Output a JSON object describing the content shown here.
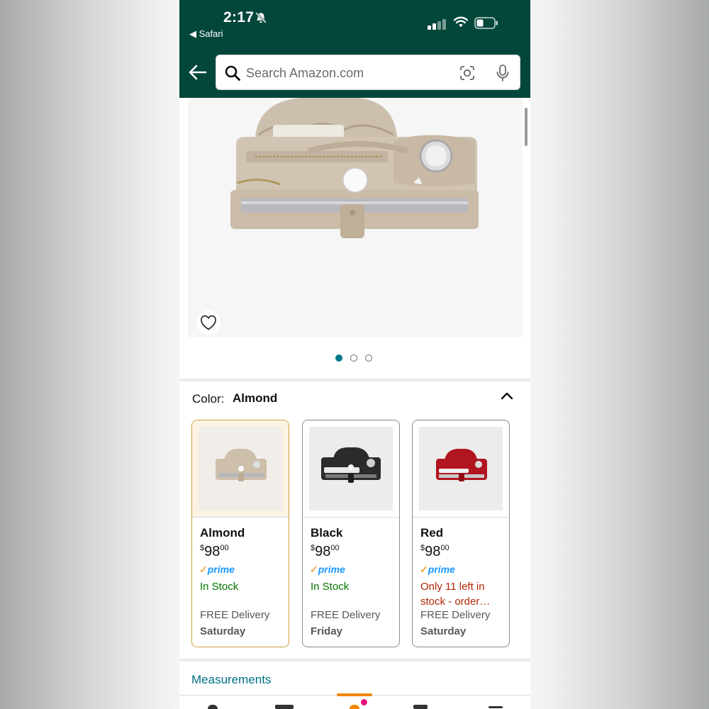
{
  "status_bar": {
    "time": "2:17",
    "back_app": "◀ Safari"
  },
  "search": {
    "placeholder": "Search Amazon.com"
  },
  "gallery": {
    "page_count": 3,
    "active_index": 0
  },
  "color_selector": {
    "label": "Color:",
    "selected": "Almond",
    "options": [
      {
        "name": "Almond",
        "price_symbol": "$",
        "price_whole": "98",
        "price_cents": "00",
        "prime_check": "✓",
        "prime": "prime",
        "stock": "In Stock",
        "delivery": "FREE Delivery",
        "delivery_day": "Saturday",
        "swatch_color": "#cdbfaa"
      },
      {
        "name": "Black",
        "price_symbol": "$",
        "price_whole": "98",
        "price_cents": "00",
        "prime_check": "✓",
        "prime": "prime",
        "stock": "In Stock",
        "delivery": "FREE Delivery",
        "delivery_day": "Friday",
        "swatch_color": "#2b2b2b"
      },
      {
        "name": "Red",
        "price_symbol": "$",
        "price_whole": "98",
        "price_cents": "00",
        "prime_check": "✓",
        "prime": "prime",
        "stock": "Only 11 left in stock - order…",
        "delivery": "FREE Delivery",
        "delivery_day": "Saturday",
        "swatch_color": "#b1151f"
      }
    ]
  },
  "measurements": {
    "label": "Measurements"
  },
  "colors": {
    "header_bg": "#03473a",
    "link": "#007185",
    "in_stock": "#007600",
    "low_stock": "#b12704",
    "prime_blue": "#1a98ff",
    "selected_border": "#d1a041"
  }
}
